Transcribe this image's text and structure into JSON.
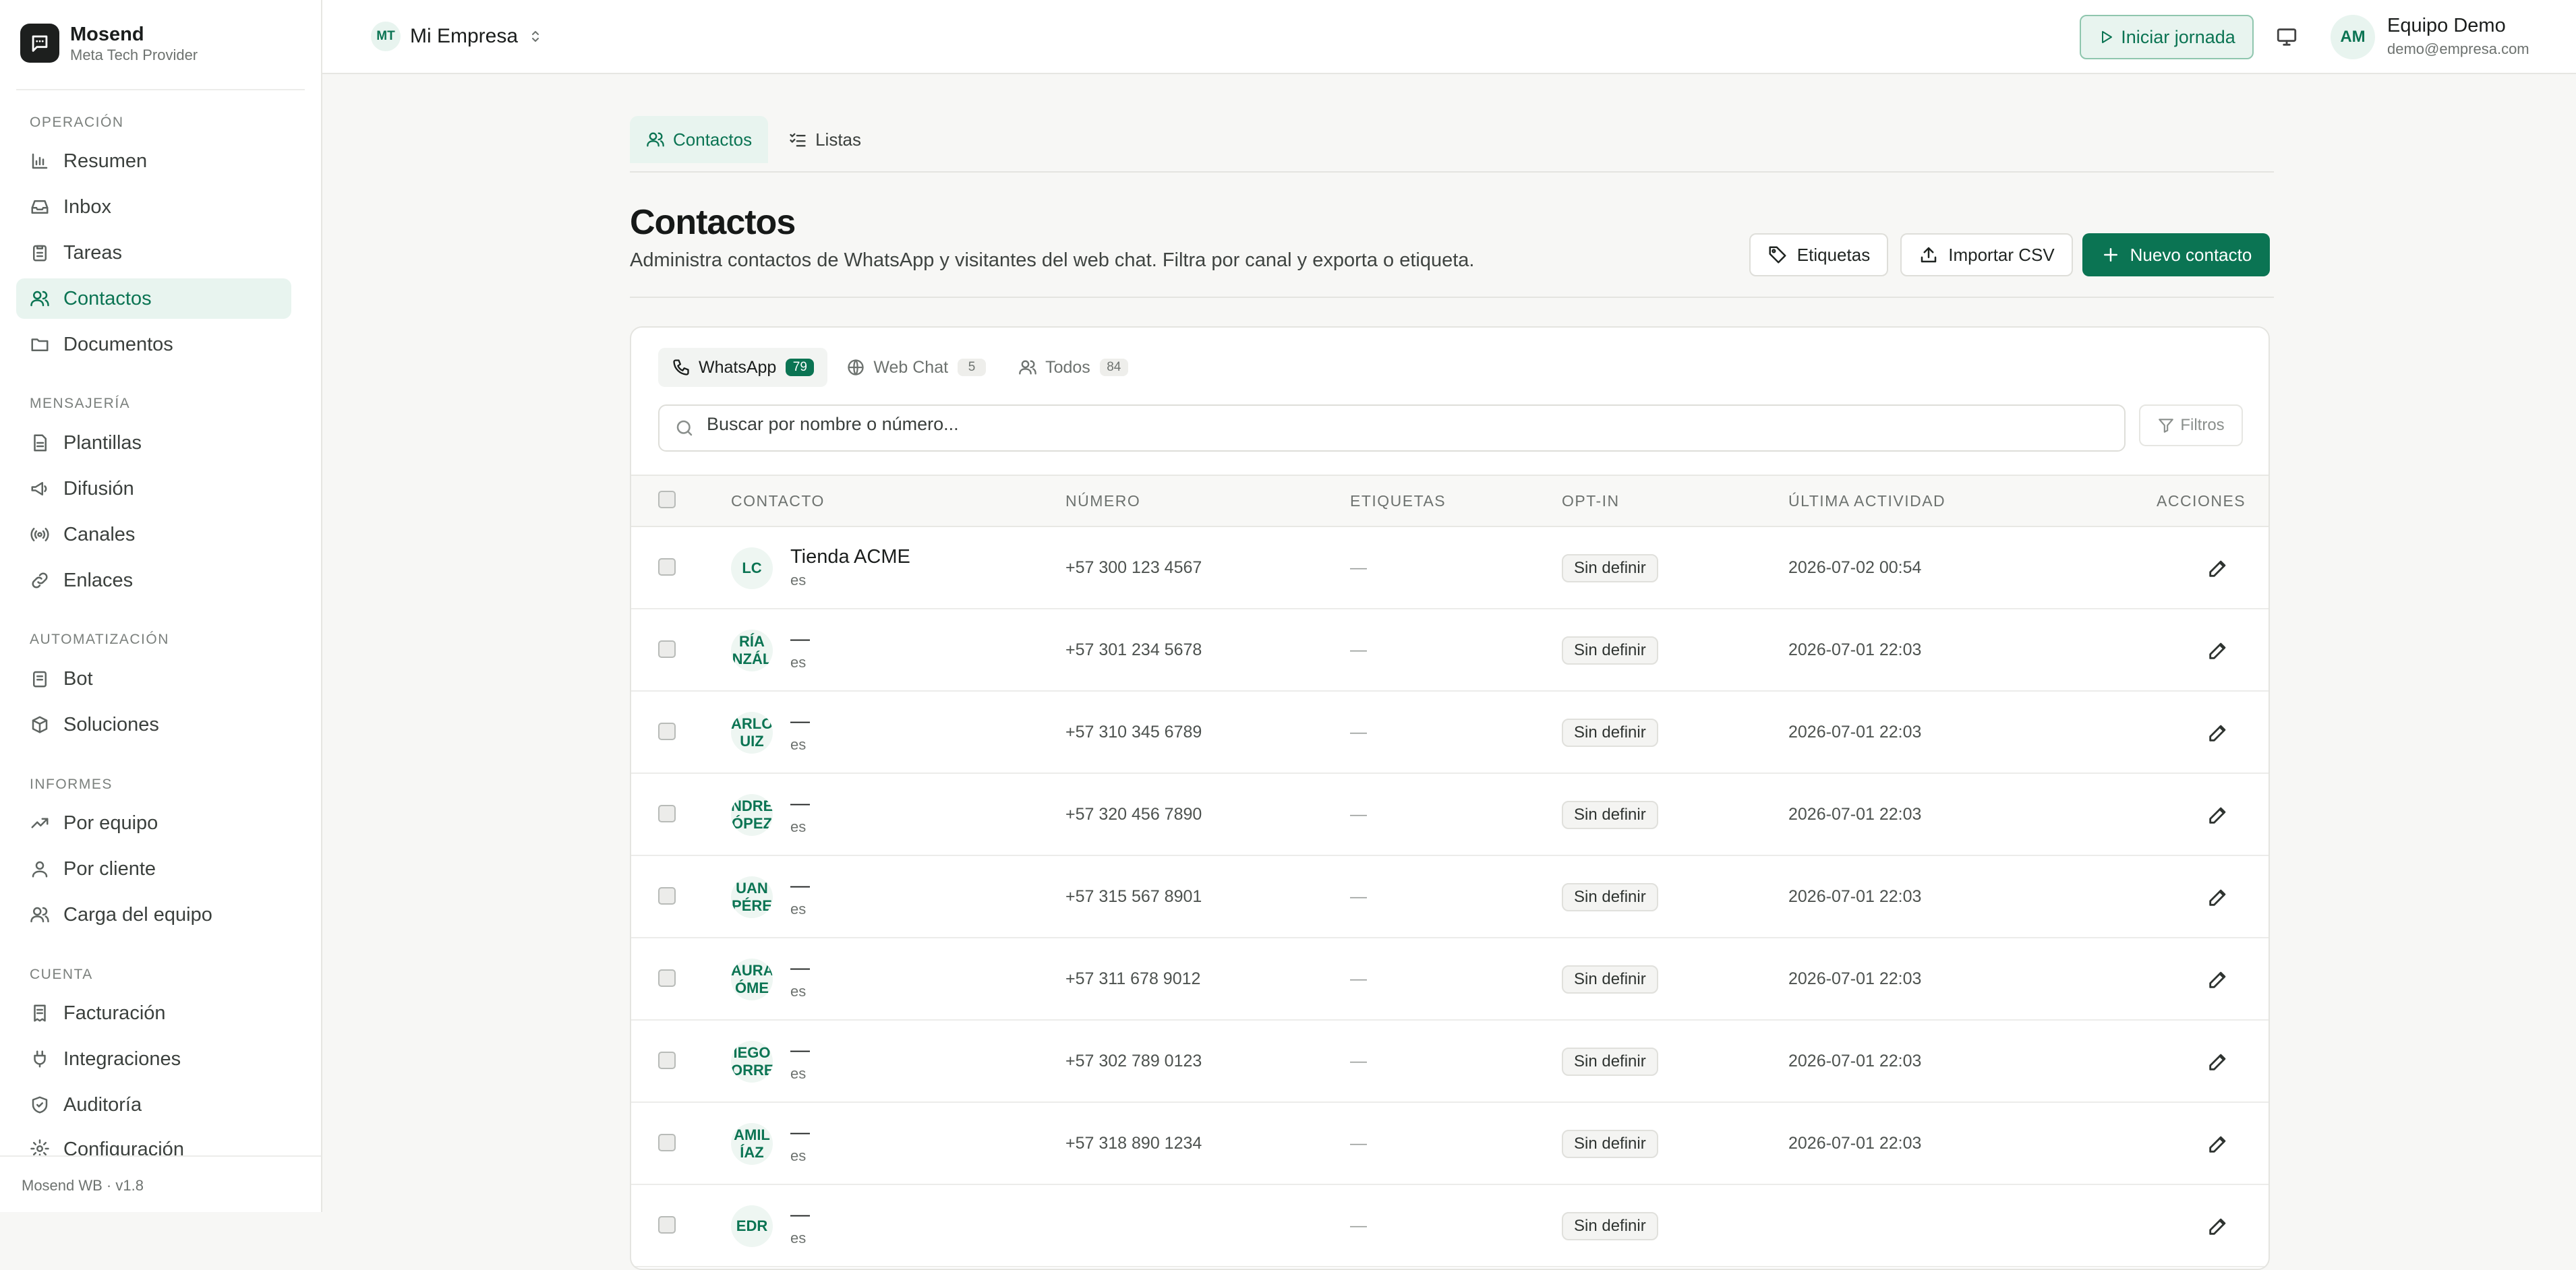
{
  "brand": {
    "name": "Mosend",
    "subtitle": "Meta Tech Provider"
  },
  "sidebar": {
    "sections": [
      {
        "title": "OPERACIÓN",
        "items": [
          {
            "label": "Resumen",
            "icon": "chart-icon"
          },
          {
            "label": "Inbox",
            "icon": "inbox-icon"
          },
          {
            "label": "Tareas",
            "icon": "clipboard-icon"
          },
          {
            "label": "Contactos",
            "icon": "users-icon",
            "active": true
          },
          {
            "label": "Documentos",
            "icon": "folder-icon"
          }
        ]
      },
      {
        "title": "MENSAJERÍA",
        "items": [
          {
            "label": "Plantillas",
            "icon": "file-icon"
          },
          {
            "label": "Difusión",
            "icon": "megaphone-icon"
          },
          {
            "label": "Canales",
            "icon": "radio-icon"
          },
          {
            "label": "Enlaces",
            "icon": "link-icon"
          }
        ]
      },
      {
        "title": "AUTOMATIZACIÓN",
        "items": [
          {
            "label": "Bot",
            "icon": "bot-icon"
          },
          {
            "label": "Soluciones",
            "icon": "box-icon"
          }
        ]
      },
      {
        "title": "INFORMES",
        "items": [
          {
            "label": "Por equipo",
            "icon": "trend-icon"
          },
          {
            "label": "Por cliente",
            "icon": "user-icon"
          },
          {
            "label": "Carga del equipo",
            "icon": "users-icon"
          }
        ]
      },
      {
        "title": "CUENTA",
        "items": [
          {
            "label": "Facturación",
            "icon": "receipt-icon"
          },
          {
            "label": "Integraciones",
            "icon": "plug-icon"
          },
          {
            "label": "Auditoría",
            "icon": "shield-icon"
          },
          {
            "label": "Configuración",
            "icon": "gear-icon"
          }
        ]
      }
    ],
    "footer": "Mosend WB · v1.8"
  },
  "topbar": {
    "org_initials": "MT",
    "org_name": "Mi Empresa",
    "start_label": "Iniciar jornada",
    "user_initials": "AM",
    "user_name": "Equipo Demo",
    "user_email": "demo@empresa.com"
  },
  "page": {
    "tabs": [
      {
        "label": "Contactos",
        "active": true
      },
      {
        "label": "Listas"
      }
    ],
    "title": "Contactos",
    "description": "Administra contactos de WhatsApp y visitantes del web chat. Filtra por canal y exporta o etiqueta.",
    "buttons": {
      "labels": "Etiquetas",
      "import": "Importar CSV",
      "new": "Nuevo contacto"
    }
  },
  "channels": [
    {
      "label": "WhatsApp",
      "count": "79",
      "active": true
    },
    {
      "label": "Web Chat",
      "count": "5"
    },
    {
      "label": "Todos",
      "count": "84"
    }
  ],
  "search": {
    "placeholder": "Buscar por nombre o número..."
  },
  "filters_label": "Filtros",
  "table": {
    "columns": [
      "CONTACTO",
      "NÚMERO",
      "ETIQUETAS",
      "OPT-IN",
      "ÚLTIMA ACTIVIDAD",
      "ACCIONES"
    ],
    "rows": [
      {
        "initials": "LC",
        "name": "Tienda ACME",
        "lang": "es",
        "number": "+57 300 123 4567",
        "tags": "—",
        "optin": "Sin definir",
        "activity": "2026-07-02 00:54"
      },
      {
        "initials": "RÍA\nNZÁL",
        "name": "—",
        "lang": "es",
        "number": "+57 301 234 5678",
        "tags": "—",
        "optin": "Sin definir",
        "activity": "2026-07-01 22:03"
      },
      {
        "initials": "ARLO\nUIZ",
        "name": "—",
        "lang": "es",
        "number": "+57 310 345 6789",
        "tags": "—",
        "optin": "Sin definir",
        "activity": "2026-07-01 22:03"
      },
      {
        "initials": "NDRE\nÓPEZ",
        "name": "—",
        "lang": "es",
        "number": "+57 320 456 7890",
        "tags": "—",
        "optin": "Sin definir",
        "activity": "2026-07-01 22:03"
      },
      {
        "initials": "UAN\nPÉRE",
        "name": "—",
        "lang": "es",
        "number": "+57 315 567 8901",
        "tags": "—",
        "optin": "Sin definir",
        "activity": "2026-07-01 22:03"
      },
      {
        "initials": "AURA\nÓME",
        "name": "—",
        "lang": "es",
        "number": "+57 311 678 9012",
        "tags": "—",
        "optin": "Sin definir",
        "activity": "2026-07-01 22:03"
      },
      {
        "initials": "IEGO\nORRE",
        "name": "—",
        "lang": "es",
        "number": "+57 302 789 0123",
        "tags": "—",
        "optin": "Sin definir",
        "activity": "2026-07-01 22:03"
      },
      {
        "initials": "AMIL\nÍAZ",
        "name": "—",
        "lang": "es",
        "number": "+57 318 890 1234",
        "tags": "—",
        "optin": "Sin definir",
        "activity": "2026-07-01 22:03"
      },
      {
        "initials": "EDR",
        "name": "—",
        "lang": "es",
        "number": "",
        "tags": "—",
        "optin": "Sin definir",
        "activity": ""
      }
    ]
  },
  "colors": {
    "accent": "#0b7453",
    "accent_soft": "#e8f4ef",
    "background": "#f7f7f5"
  }
}
